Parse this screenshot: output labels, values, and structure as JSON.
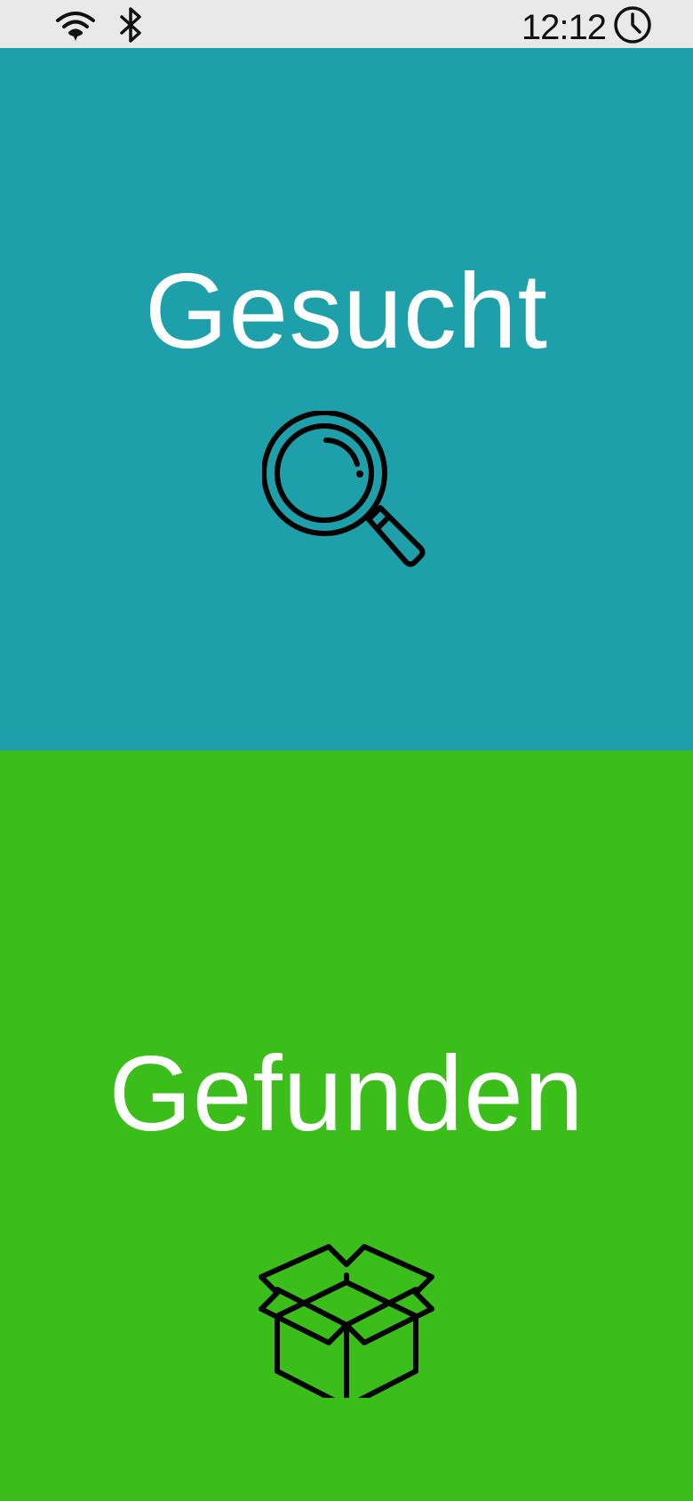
{
  "status_bar": {
    "time": "12:12",
    "icons": [
      "wifi-icon",
      "bluetooth-icon",
      "clock-icon"
    ]
  },
  "panels": [
    {
      "title": "Gesucht",
      "icon": "magnifier-icon",
      "background": "#1ea0aa"
    },
    {
      "title": "Gefunden",
      "icon": "open-box-icon",
      "background": "#3bbd1a"
    }
  ]
}
